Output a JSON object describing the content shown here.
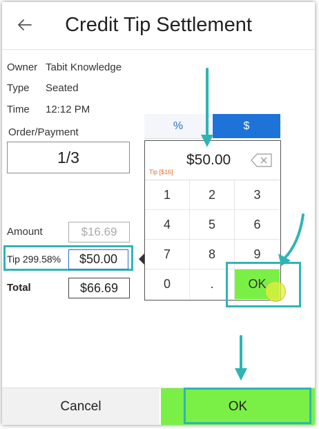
{
  "header": {
    "title": "Credit Tip Settlement",
    "back_icon": "arrow-left-icon"
  },
  "info": [
    {
      "key": "Owner",
      "value": "Tabit Knowledge"
    },
    {
      "key": "Type",
      "value": "Seated"
    },
    {
      "key": "Time",
      "value": "12:12 PM"
    }
  ],
  "order": {
    "label": "Order/Payment",
    "value": "1/3"
  },
  "amount": {
    "label": "Amount",
    "value": "$16.69"
  },
  "tip": {
    "label": "Tip 299.58%",
    "value": "$50.00"
  },
  "total": {
    "label": "Total",
    "value": "$66.69"
  },
  "toggle": {
    "percent": "%",
    "dollar": "$",
    "selected": "$"
  },
  "keypad": {
    "display": "$50.00",
    "tip_label": "Tip [$16]",
    "keys": [
      "1",
      "2",
      "3",
      "4",
      "5",
      "6",
      "7",
      "8",
      "9",
      "0",
      ".",
      "OK"
    ]
  },
  "footer": {
    "cancel": "Cancel",
    "ok": "OK"
  },
  "colors": {
    "accent_blue": "#1e73d9",
    "ok_green": "#7af046",
    "highlight_teal": "#2fb4b4",
    "tip_orange": "#e07020"
  }
}
